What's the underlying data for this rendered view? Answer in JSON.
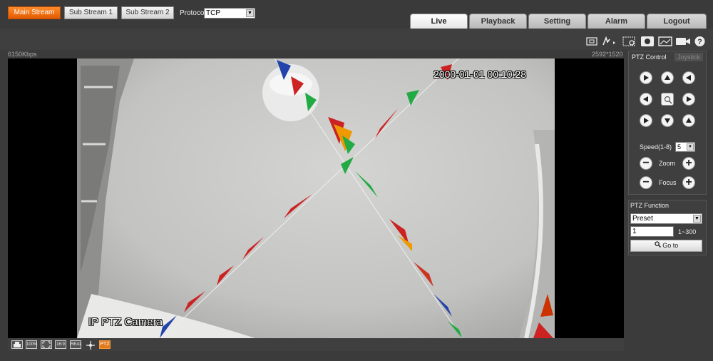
{
  "nav": {
    "tabs": [
      {
        "label": "Live",
        "active": true
      },
      {
        "label": "Playback",
        "active": false
      },
      {
        "label": "Setting",
        "active": false
      },
      {
        "label": "Alarm",
        "active": false
      },
      {
        "label": "Logout",
        "active": false
      }
    ]
  },
  "toolbar": {
    "streams": [
      {
        "label": "Main Stream",
        "active": true
      },
      {
        "label": "Sub Stream 1",
        "active": false
      },
      {
        "label": "Sub Stream 2",
        "active": false
      }
    ],
    "protocol_label": "Protocol",
    "protocol_value": "TCP",
    "icons": [
      "zoom-region-icon",
      "draw-icon",
      "digital-zoom-icon",
      "record-icon",
      "snapshot-icon",
      "video-record-icon",
      "help-icon"
    ]
  },
  "status": {
    "bitrate": "6150Kbps",
    "resolution": "2592*1520"
  },
  "video": {
    "osd_time": "2000-01-01 00:10:28",
    "osd_name": "IP PTZ Camera"
  },
  "bottombar": {
    "icons": [
      {
        "name": "original-size-icon",
        "text": ""
      },
      {
        "name": "scale-100-icon",
        "text": "100%"
      },
      {
        "name": "fullscreen-icon",
        "text": ""
      },
      {
        "name": "ratio-icon",
        "text": "16:9"
      },
      {
        "name": "fluency-icon",
        "text": "REAL"
      },
      {
        "name": "rule-icon",
        "text": ""
      },
      {
        "name": "ptz-toggle-icon",
        "text": "PTZ"
      }
    ]
  },
  "ptz": {
    "tabs": [
      {
        "label": "PTZ Control",
        "active": true
      },
      {
        "label": "Joystick",
        "active": false
      }
    ],
    "speed_label": "Speed(1-8)",
    "speed_value": "5",
    "zoom_label": "Zoom",
    "focus_label": "Focus"
  },
  "ptz_function": {
    "title": "PTZ Function",
    "mode_value": "Preset",
    "preset_value": "1",
    "preset_range": "1~300",
    "goto_label": "Go to"
  },
  "colors": {
    "accent": "#e25a00",
    "panel": "#3f3f3f"
  }
}
